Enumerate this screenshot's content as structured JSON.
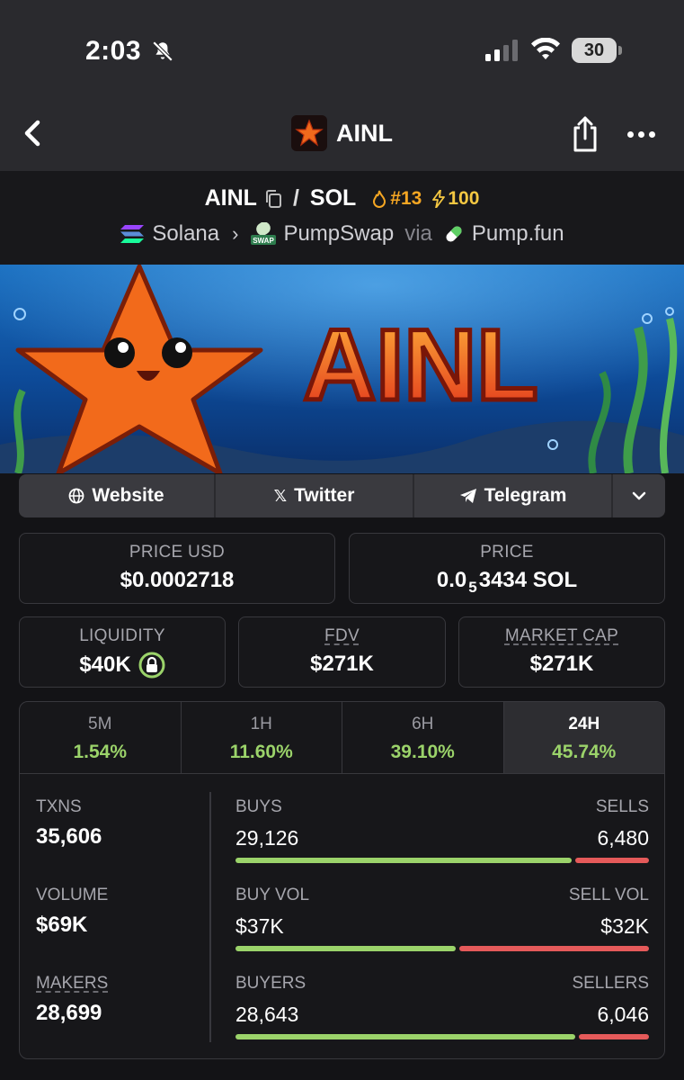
{
  "status_bar": {
    "time": "2:03",
    "battery": "30"
  },
  "nav": {
    "title": "AINL"
  },
  "pair": {
    "base": "AINL",
    "separator": "/",
    "quote": "SOL",
    "rank": "#13",
    "boost": "100",
    "chain": "Solana",
    "dex": "PumpSwap",
    "via": "via",
    "launchpad": "Pump.fun",
    "dex_badge": "SWAP"
  },
  "banner": {
    "text": "AINL"
  },
  "socials": [
    {
      "label": "Website"
    },
    {
      "label": "Twitter"
    },
    {
      "label": "Telegram"
    }
  ],
  "stats": {
    "price_usd_label": "PRICE USD",
    "price_usd": "$0.0002718",
    "price_label": "PRICE",
    "price_prefix": "0.0",
    "price_sub": "5",
    "price_suffix": "3434 SOL",
    "liquidity_label": "LIQUIDITY",
    "liquidity": "$40K",
    "fdv_label": "FDV",
    "fdv": "$271K",
    "mcap_label": "MARKET CAP",
    "mcap": "$271K"
  },
  "timeframes": [
    {
      "label": "5M",
      "change": "1.54%"
    },
    {
      "label": "1H",
      "change": "11.60%"
    },
    {
      "label": "6H",
      "change": "39.10%"
    },
    {
      "label": "24H",
      "change": "45.74%"
    }
  ],
  "active_timeframe": "24H",
  "activity": {
    "txns_label": "TXNS",
    "txns": "35,606",
    "volume_label": "VOLUME",
    "volume": "$69K",
    "makers_label": "MAKERS",
    "makers": "28,699",
    "buys_label": "BUYS",
    "buys": "29,126",
    "sells_label": "SELLS",
    "sells": "6,480",
    "buy_vol_label": "BUY VOL",
    "buy_vol": "$37K",
    "sell_vol_label": "SELL VOL",
    "sell_vol": "$32K",
    "buyers_label": "BUYERS",
    "buyers": "28,643",
    "sellers_label": "SELLERS",
    "sellers": "6,046",
    "buy_ratio": 0.818,
    "buy_vol_ratio": 0.536,
    "buyers_ratio": 0.826
  },
  "colors": {
    "positive": "#9bd36a",
    "negative": "#e55a5a",
    "rank": "#f5a623",
    "boost": "#f5c842"
  }
}
